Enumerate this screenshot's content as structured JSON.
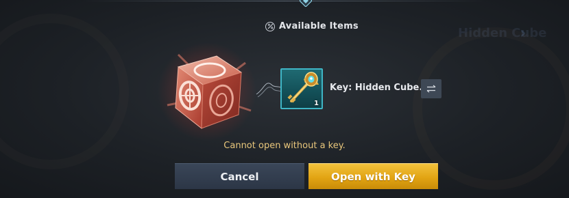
{
  "header": {
    "title": "Available Items",
    "title_icon": "percent-circle-icon"
  },
  "background": {
    "ghost_text": "Hidden Cube"
  },
  "item": {
    "icon": "golden-key-icon",
    "count": "1",
    "name": "Key: Hidden Cube...",
    "swap_icon": "swap-arrows-icon",
    "slot_border_color": "#3fb6c6"
  },
  "cube": {
    "icon": "hidden-cube-icon"
  },
  "message": "Cannot open without a key.",
  "buttons": {
    "cancel_label": "Cancel",
    "open_label": "Open with Key"
  },
  "colors": {
    "message_color": "#e9c77c",
    "open_button": "#e2a413",
    "cancel_button": "#323d4f"
  }
}
